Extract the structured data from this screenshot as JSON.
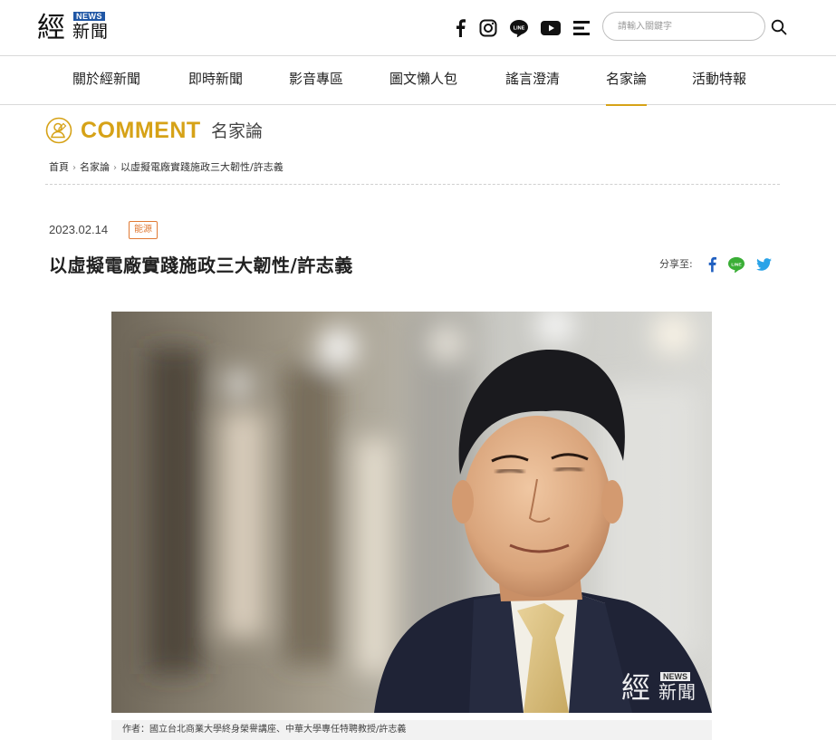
{
  "header": {
    "logo": {
      "big": "經",
      "news": "NEWS",
      "small": "新聞"
    },
    "social_icons": [
      "facebook-icon",
      "instagram-icon",
      "line-icon",
      "youtube-icon",
      "menu-icon"
    ],
    "search": {
      "placeholder": "請輸入關鍵字"
    }
  },
  "nav": {
    "items": [
      {
        "label": "關於經新聞"
      },
      {
        "label": "即時新聞"
      },
      {
        "label": "影音專區"
      },
      {
        "label": "圖文懶人包"
      },
      {
        "label": "謠言澄清"
      },
      {
        "label": "名家論",
        "active": true
      },
      {
        "label": "活動特報"
      }
    ]
  },
  "section": {
    "title_en": "COMMENT",
    "title_zh": "名家論"
  },
  "breadcrumb": [
    "首頁",
    "名家論",
    "以虛擬電廠實踐施政三大韌性/許志義"
  ],
  "article": {
    "date": "2023.02.14",
    "tag": "能源",
    "title": "以虛擬電廠實踐施政三大韌性/許志義",
    "share_label": "分享至:",
    "share_icons": [
      "facebook-icon",
      "line-icon",
      "twitter-icon"
    ],
    "watermark": {
      "big": "經",
      "news": "NEWS",
      "small": "新聞"
    },
    "caption": "作者：國立台北商業大學終身榮譽講座、中華大學專任特聘教授/許志義"
  },
  "colors": {
    "accent": "#d6a217",
    "tag": "#e07a35",
    "facebook": "#1f5fc0",
    "line": "#3aae36",
    "twitter": "#2aa3e8",
    "news_badge": "#1f56a5"
  }
}
